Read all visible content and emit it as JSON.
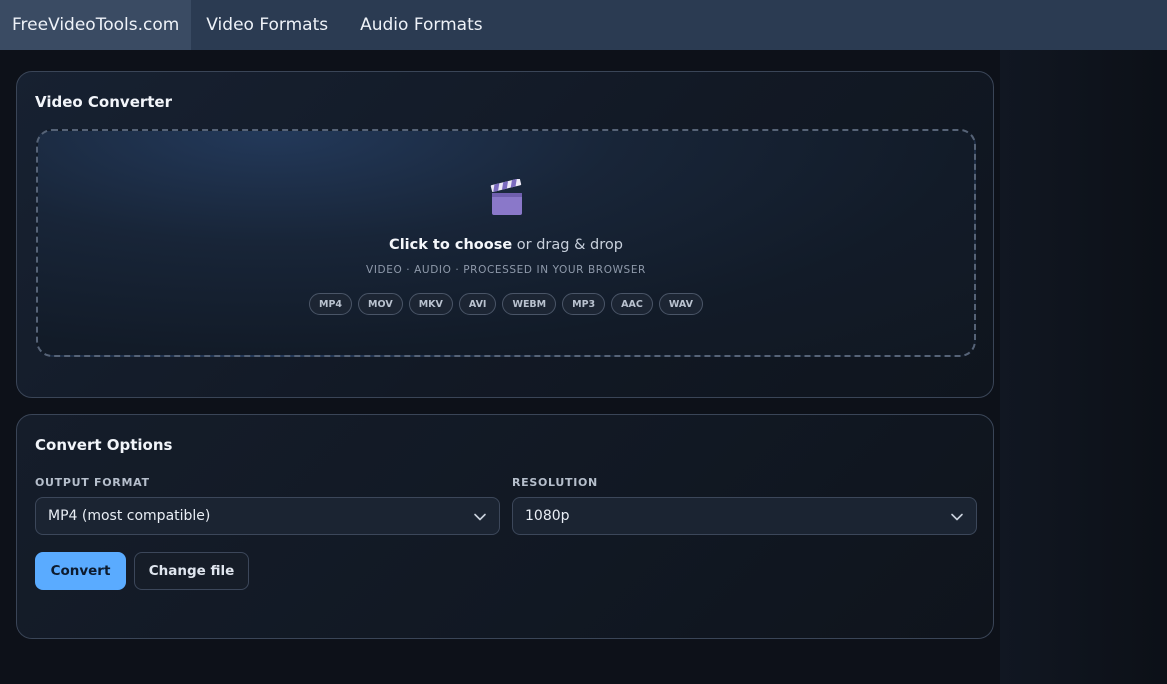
{
  "nav": {
    "brand": "FreeVideoTools.com",
    "items": [
      "Video Formats",
      "Audio Formats"
    ]
  },
  "converter": {
    "title": "Video Converter",
    "dropzone": {
      "icon": "clapperboard-icon",
      "cta_strong": "Click to choose",
      "cta_rest": " or drag & drop",
      "subtitle": "VIDEO · AUDIO · PROCESSED IN YOUR BROWSER",
      "formats": [
        "MP4",
        "MOV",
        "MKV",
        "AVI",
        "WEBM",
        "MP3",
        "AAC",
        "WAV"
      ]
    }
  },
  "options": {
    "title": "Convert Options",
    "output_format": {
      "label": "OUTPUT FORMAT",
      "value": "MP4 (most compatible)"
    },
    "resolution": {
      "label": "RESOLUTION",
      "value": "1080p"
    },
    "convert_label": "Convert",
    "change_file_label": "Change file"
  },
  "colors": {
    "nav_bg": "#2b3b52",
    "accent": "#5aabff",
    "page_bg": "#0d1119"
  }
}
